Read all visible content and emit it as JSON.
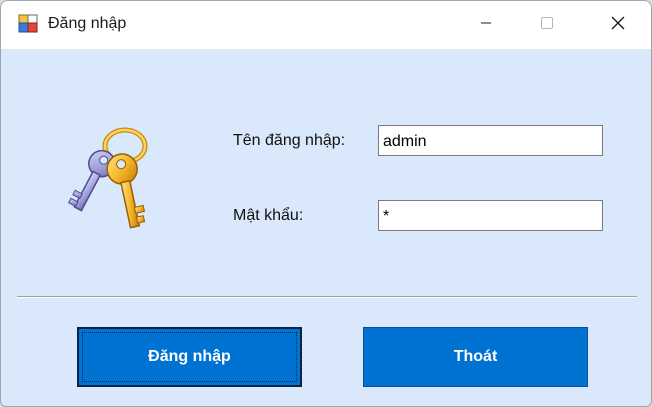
{
  "window": {
    "title": "Đăng nhập",
    "app_icon": "window-app-icon",
    "controls": {
      "minimize_icon": "minimize-icon",
      "maximize_icon": "maximize-icon",
      "close_icon": "close-icon"
    }
  },
  "form": {
    "icon": "keys-icon",
    "username": {
      "label": "Tên đăng nhập:",
      "value": "admin"
    },
    "password": {
      "label": "Mật khẩu:",
      "value": "*"
    }
  },
  "buttons": {
    "login_label": "Đăng nhập",
    "exit_label": "Thoát"
  },
  "colors": {
    "form_background": "#d9e8fa",
    "button_fill": "#0072d2",
    "button_text": "#ffffff",
    "titlebar": "#ffffff"
  }
}
